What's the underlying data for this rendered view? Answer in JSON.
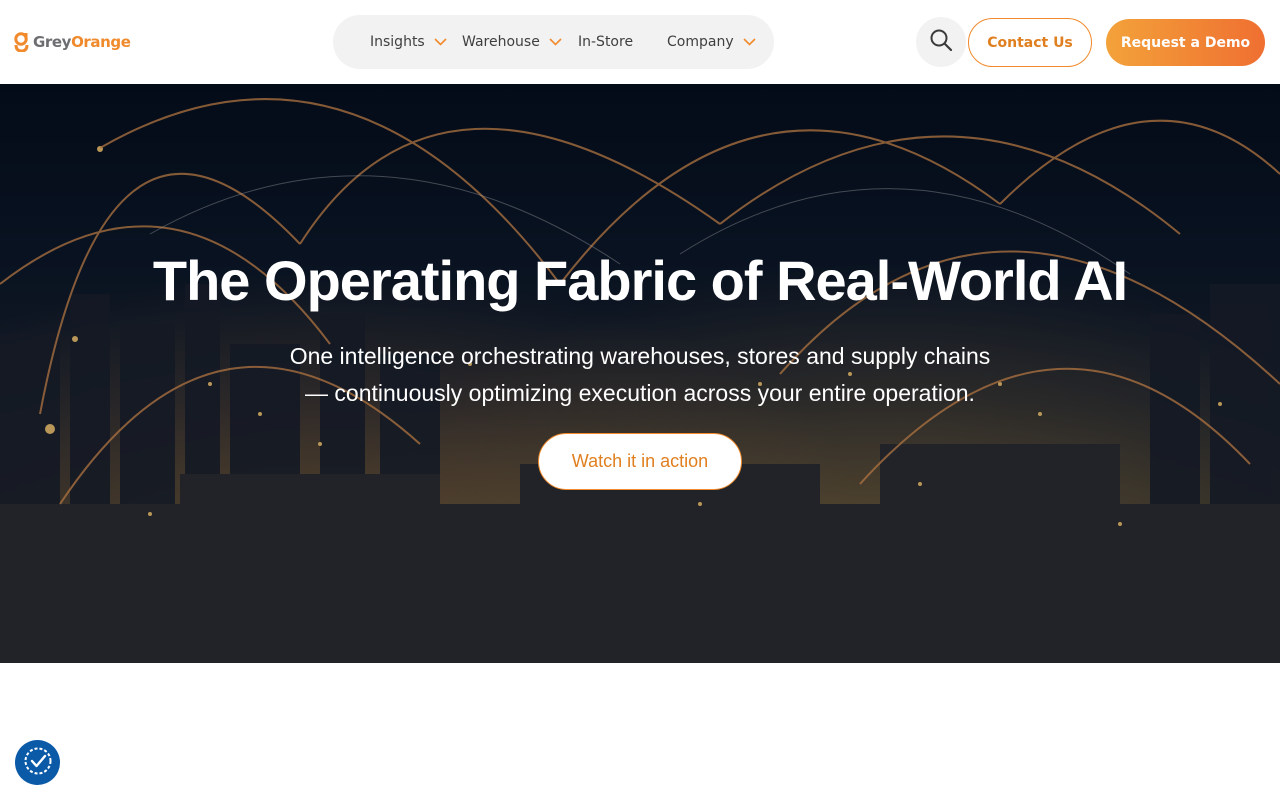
{
  "brand": {
    "logo_part1": "Grey",
    "logo_part2": "Orange",
    "orange": "#f08a2c",
    "grey": "#6d6e71"
  },
  "nav": {
    "items": [
      {
        "label": "Insights",
        "has_dropdown": true
      },
      {
        "label": "Warehouse",
        "has_dropdown": true
      },
      {
        "label": "In-Store",
        "has_dropdown": false
      },
      {
        "label": "Company",
        "has_dropdown": true
      }
    ],
    "search_icon": "search-icon",
    "contact_label": "Contact Us",
    "demo_label": "Request a Demo"
  },
  "hero": {
    "title": "The Operating Fabric of Real-World AI",
    "subtitle_line1": "One intelligence orchestrating warehouses, stores and supply chains",
    "subtitle_line2": "— continuously optimizing execution across your entire operation.",
    "cta_label": "Watch it in action"
  },
  "accessibility": {
    "icon": "accessibility-icon",
    "color": "#0b5aa8"
  }
}
